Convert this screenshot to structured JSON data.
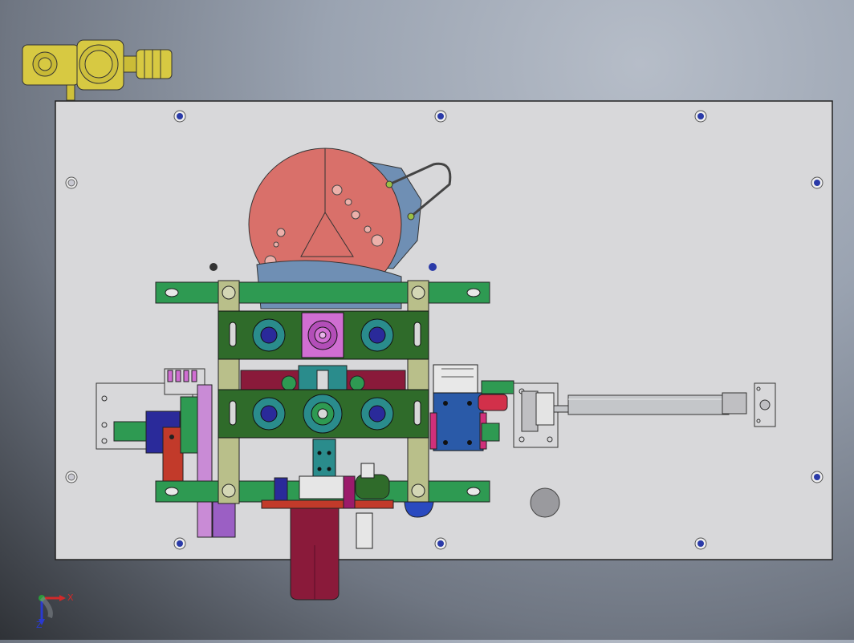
{
  "viewport": {
    "background_top": "#b6bdc8",
    "background_bottom": "#2f3237"
  },
  "colors": {
    "baseplate": "#d8d8da",
    "frame_green": "#2e9a52",
    "dark_green": "#2f6b2a",
    "olive": "#b9bf8a",
    "salmon": "#d9706a",
    "steel_blue": "#6f8fb4",
    "pink": "#d06ed2",
    "navy": "#2a2a9a",
    "maroon": "#8a1a3a",
    "teal": "#2a8c8c",
    "brass": "#d7c942",
    "cylinder_gray": "#c4c6c9",
    "red": "#c23a2a",
    "purple": "#9b5fc4"
  },
  "triad": {
    "x_label": "X",
    "z_label": "Z"
  }
}
